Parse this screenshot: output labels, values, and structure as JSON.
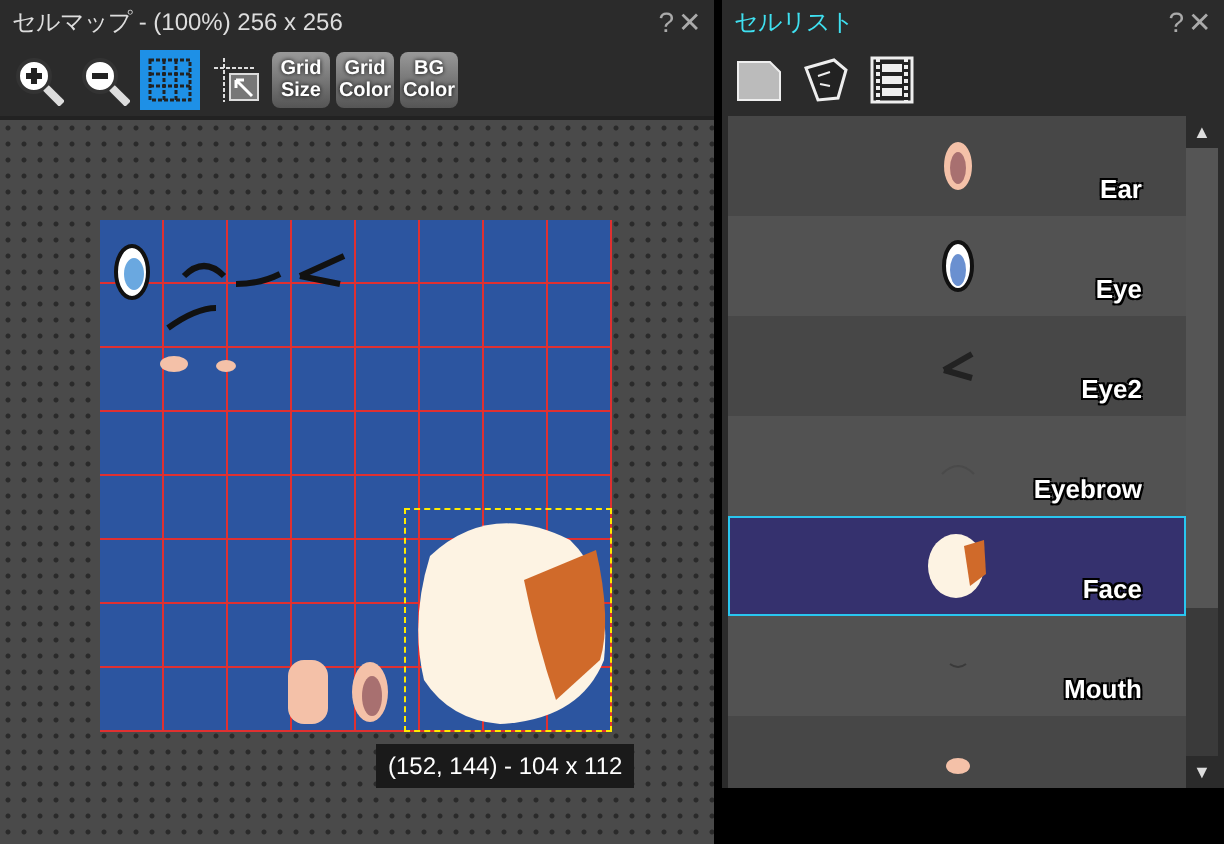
{
  "cell_map": {
    "title": "セルマップ - (100%) 256 x 256",
    "help": "?",
    "close": "✕",
    "toolbar": [
      {
        "kind": "zoom-in",
        "selected": false
      },
      {
        "kind": "zoom-out",
        "selected": false
      },
      {
        "kind": "grid",
        "selected": true
      },
      {
        "kind": "region-select",
        "selected": false
      },
      {
        "kind": "text",
        "lines": [
          "Grid",
          "Size"
        ]
      },
      {
        "kind": "text",
        "lines": [
          "Grid",
          "Color"
        ]
      },
      {
        "kind": "text",
        "lines": [
          "BG",
          "Color"
        ]
      }
    ],
    "tooltip": "(152, 144) - 104 x 112"
  },
  "cell_list": {
    "title": "セルリスト",
    "help": "?",
    "close": "✕",
    "toolbar": [
      {
        "kind": "page"
      },
      {
        "kind": "mask"
      },
      {
        "kind": "film"
      }
    ],
    "scroll_up": "▲",
    "scroll_down": "▼",
    "items": [
      {
        "kind": "ear",
        "name": "Ear",
        "selected": false
      },
      {
        "kind": "eye",
        "name": "Eye",
        "selected": false
      },
      {
        "kind": "eye2",
        "name": "Eye2",
        "selected": false
      },
      {
        "kind": "eyebrow",
        "name": "Eyebrow",
        "selected": false
      },
      {
        "kind": "face",
        "name": "Face",
        "selected": true
      },
      {
        "kind": "mouth",
        "name": "Mouth",
        "selected": false
      },
      {
        "kind": "nose",
        "selected": false
      }
    ]
  }
}
